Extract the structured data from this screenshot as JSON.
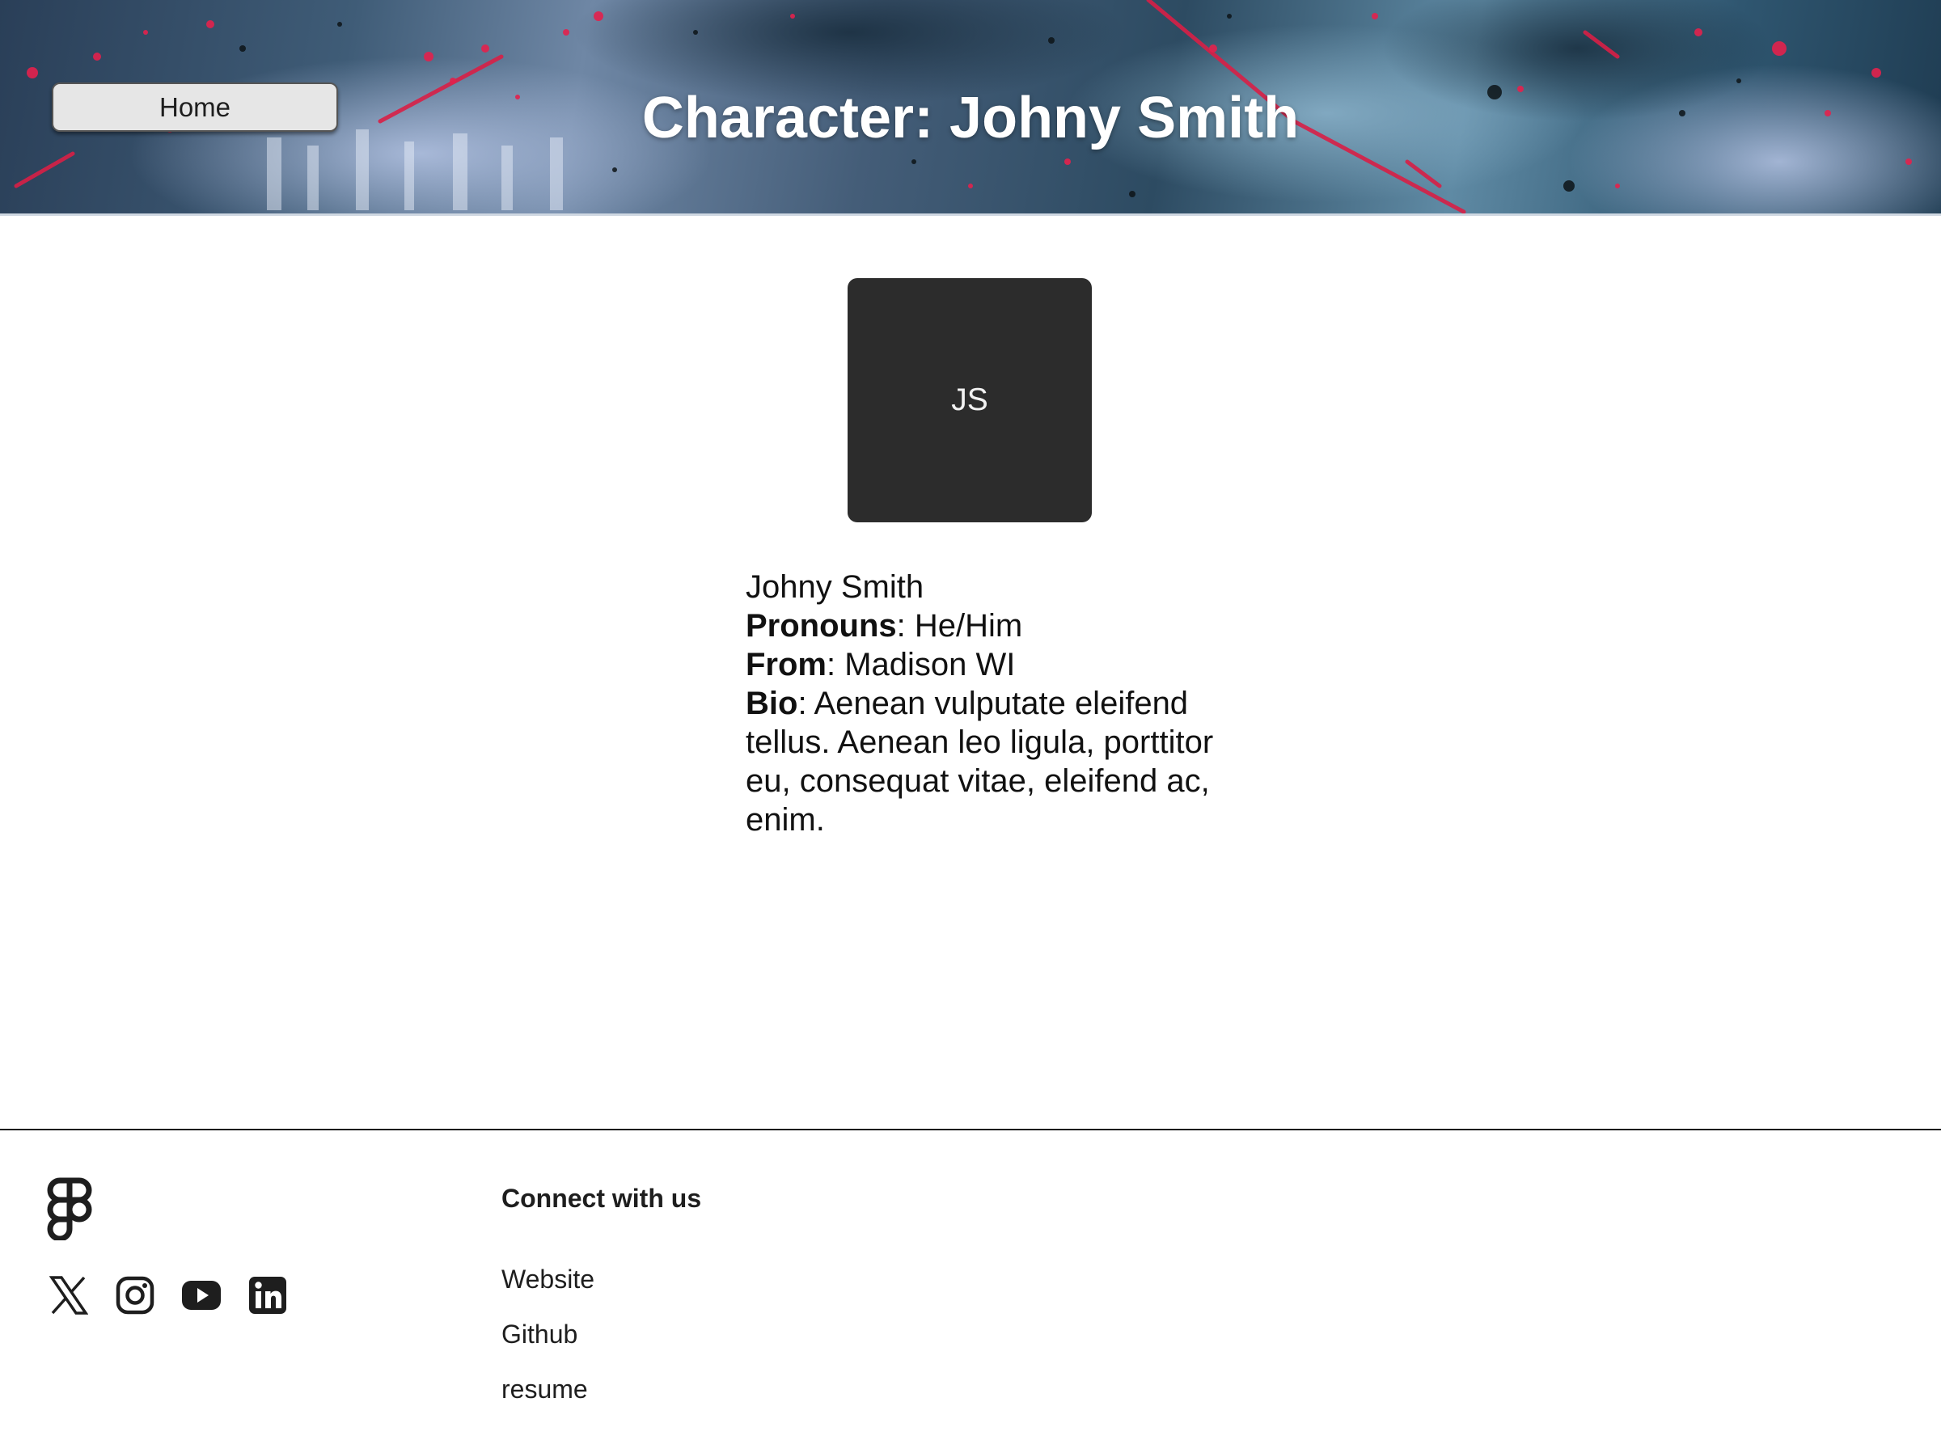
{
  "header": {
    "home_label": "Home",
    "title": "Character: Johny Smith"
  },
  "profile": {
    "avatar_initials": "JS",
    "name": "Johny Smith",
    "pronouns_label": "Pronouns",
    "pronouns_value": ": He/Him",
    "from_label": "From",
    "from_value": ": Madison WI",
    "bio_label": "Bio",
    "bio_value": ": Aenean vulputate eleifend tellus. Aenean leo ligula, porttitor eu, consequat vitae, eleifend ac, enim."
  },
  "footer": {
    "logo_icon": "figma-logo-icon",
    "social_icons": [
      "x-icon",
      "instagram-icon",
      "youtube-icon",
      "linkedin-icon"
    ],
    "connect_title": "Connect with us",
    "links": [
      "Website",
      "Github",
      "resume"
    ]
  },
  "colors": {
    "header_text": "#ffffff",
    "avatar_bg": "#2c2c2c",
    "button_bg": "#e6e6e6",
    "accent_splatter": "#e0204a"
  }
}
